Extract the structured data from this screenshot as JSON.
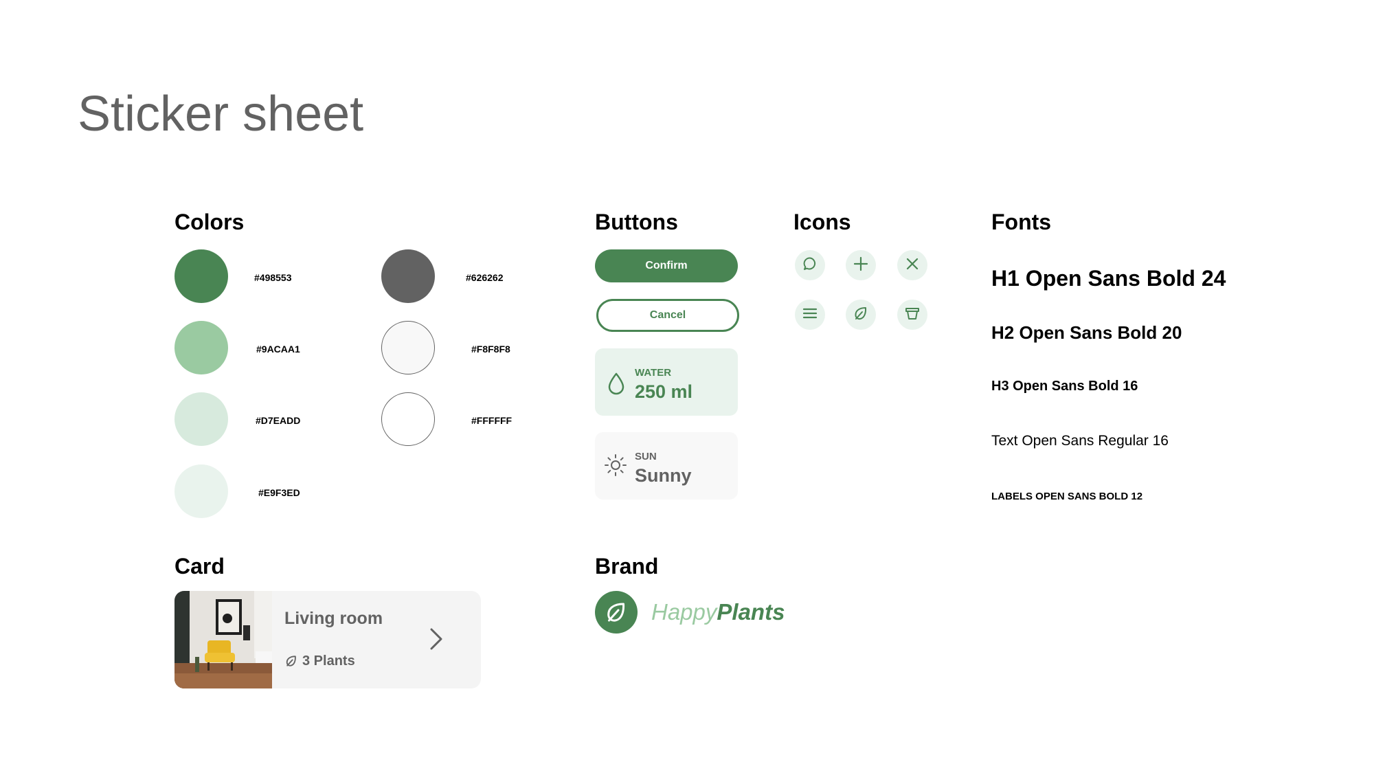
{
  "title": "Sticker sheet",
  "sections": {
    "colors": "Colors",
    "buttons": "Buttons",
    "icons": "Icons",
    "fonts": "Fonts",
    "card": "Card",
    "brand": "Brand"
  },
  "colors": [
    {
      "hex": "#498553"
    },
    {
      "hex": "#9ACAA1"
    },
    {
      "hex": "#D7EADD"
    },
    {
      "hex": "#E9F3ED"
    },
    {
      "hex": "#626262"
    },
    {
      "hex": "#F8F8F8"
    },
    {
      "hex": "#FFFFFF"
    }
  ],
  "buttons": {
    "confirm": "Confirm",
    "cancel": "Cancel",
    "water": {
      "label": "WATER",
      "value": "250 ml",
      "icon": "water-drop-icon"
    },
    "sun": {
      "label": "SUN",
      "value": "Sunny",
      "icon": "sun-icon"
    }
  },
  "icons": [
    "chat-bubble-icon",
    "plus-icon",
    "close-icon",
    "menu-icon",
    "leaf-icon",
    "pot-icon"
  ],
  "fonts": {
    "h1": "H1 Open Sans Bold 24",
    "h2": "H2 Open Sans Bold 20",
    "h3": "H3 Open Sans Bold 16",
    "text": "Text Open Sans Regular 16",
    "labels": "LABELS OPEN SANS BOLD 12"
  },
  "card": {
    "title": "Living room",
    "count": "3 Plants",
    "image": "living-room-photo"
  },
  "brand": {
    "name_part1": "Happy",
    "name_part2": "Plants",
    "logo": "leaf-logo-icon"
  },
  "palette": {
    "primary": "#498553",
    "light": "#9ACAA1",
    "lighter": "#D7EADD",
    "lightest": "#E9F3ED",
    "grey": "#626262",
    "offwhite": "#F8F8F8"
  }
}
